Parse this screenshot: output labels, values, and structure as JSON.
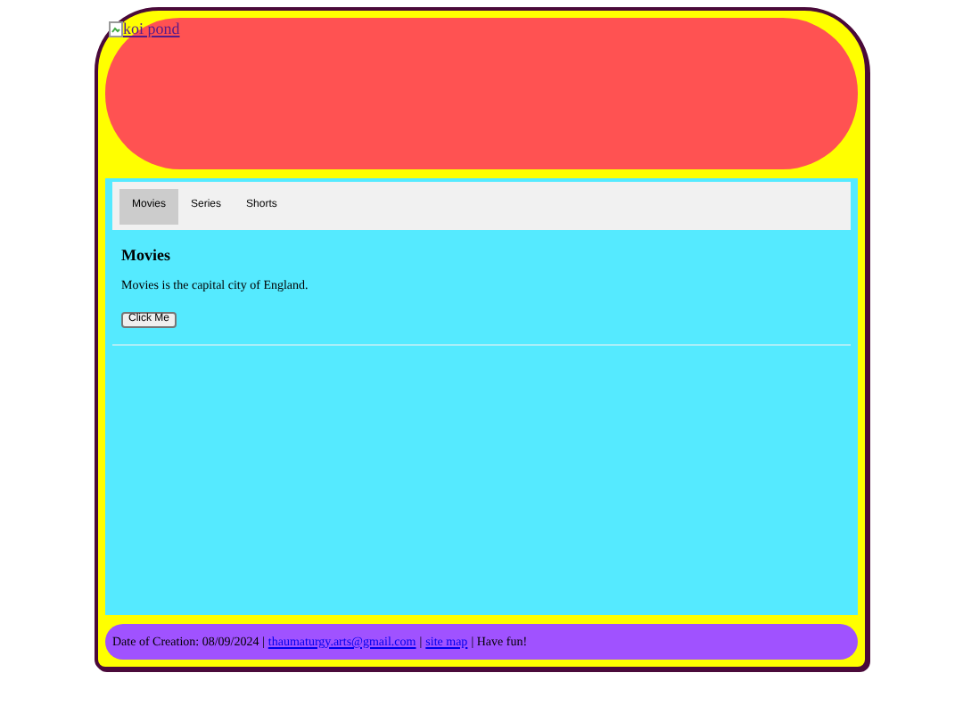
{
  "header": {
    "image": {
      "alt": "koi pond"
    }
  },
  "tabs": [
    {
      "label": "Movies",
      "selected": true
    },
    {
      "label": "Series",
      "selected": false
    },
    {
      "label": "Shorts",
      "selected": false
    }
  ],
  "content": {
    "heading": "Movies",
    "text": "Movies is the capital city of England.",
    "button": "Click Me"
  },
  "footer": {
    "parts": [
      {
        "kind": "text",
        "text": "Date of Creation: 08/09/2024 |"
      },
      {
        "kind": "link",
        "text": "thaumaturgy.arts@gmail.com"
      },
      {
        "kind": "text",
        "text": "|"
      },
      {
        "kind": "link",
        "text": "site map"
      },
      {
        "kind": "text",
        "text": "| Have fun!"
      }
    ]
  }
}
